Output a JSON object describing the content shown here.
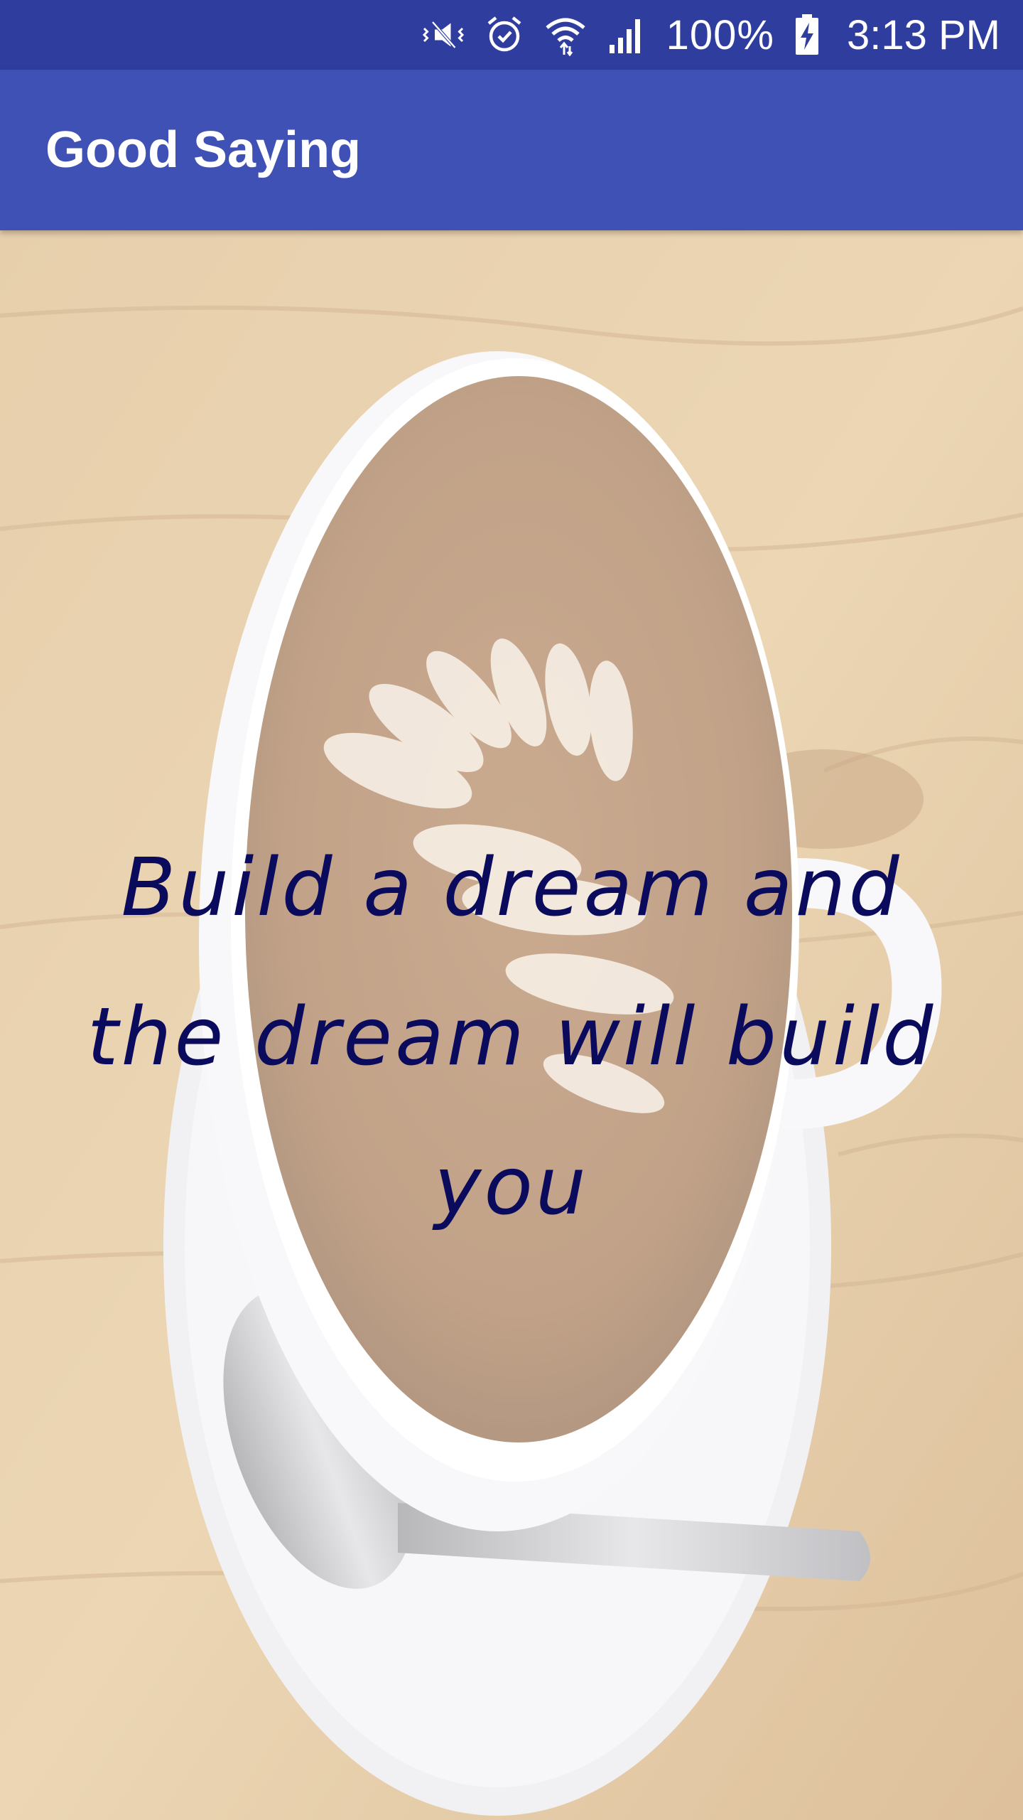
{
  "status_bar": {
    "icons": [
      "vibrate-icon",
      "alarm-icon",
      "wifi-icon",
      "signal-icon",
      "battery-charging-icon"
    ],
    "battery": "100%",
    "time": "3:13 PM"
  },
  "app_bar": {
    "title": "Good Saying",
    "color": "#3f51b5"
  },
  "main": {
    "background": "latte-cup-photo",
    "quote": "Build a dream and the dream will build you",
    "quote_color": "#0b0b5e"
  }
}
